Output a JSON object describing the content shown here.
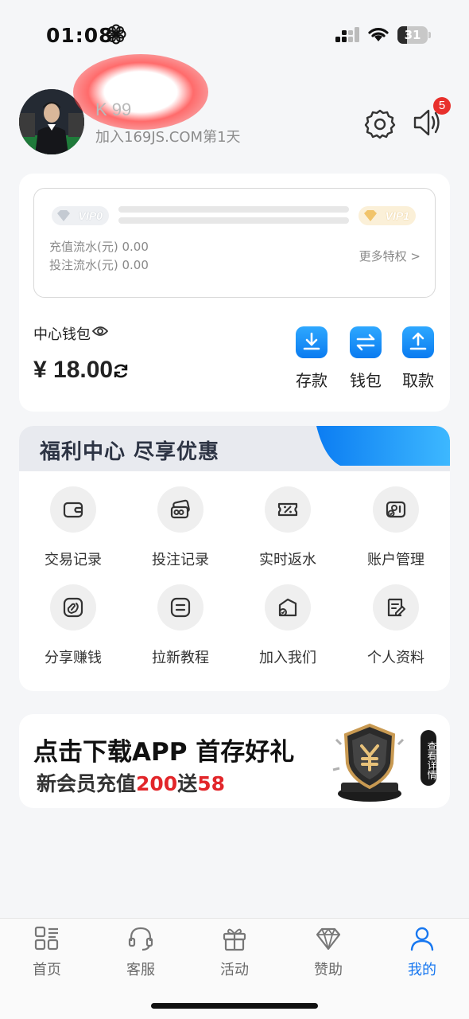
{
  "status_bar": {
    "time": "01:08",
    "battery": "31",
    "battery_level": 0.31
  },
  "profile": {
    "username": "K      99",
    "join_text": "加入169JS.COM第1天",
    "notification_count": "5"
  },
  "vip": {
    "current_level": "VIP0",
    "next_level": "VIP1",
    "recharge_flow": "充值流水(元) 0.00",
    "bet_flow": "投注流水(元) 0.00",
    "more_privileges": "更多特权 >"
  },
  "wallet": {
    "title": "中心钱包",
    "balance": "¥ 18.00",
    "actions": [
      {
        "label": "存款",
        "icon": "download-icon"
      },
      {
        "label": "钱包",
        "icon": "transfer-icon"
      },
      {
        "label": "取款",
        "icon": "upload-icon"
      }
    ]
  },
  "welfare": {
    "title": "福利中心 尽享优惠",
    "items": [
      {
        "label": "交易记录",
        "icon": "wallet-icon"
      },
      {
        "label": "投注记录",
        "icon": "bet-card-icon"
      },
      {
        "label": "实时返水",
        "icon": "rebate-icon"
      },
      {
        "label": "账户管理",
        "icon": "account-card-icon"
      },
      {
        "label": "分享赚钱",
        "icon": "share-icon"
      },
      {
        "label": "拉新教程",
        "icon": "tutorial-icon"
      },
      {
        "label": "加入我们",
        "icon": "bag-icon"
      },
      {
        "label": "个人资料",
        "icon": "profile-doc-icon"
      }
    ]
  },
  "banner": {
    "title": "点击下载APP 首存好礼",
    "sub_prefix": "新会员充值",
    "sub_amount1": "200",
    "sub_mid": "送",
    "sub_amount2": "58",
    "view_detail": "查看详情"
  },
  "bottom_nav": {
    "items": [
      {
        "label": "首页",
        "icon": "home-grid-icon"
      },
      {
        "label": "客服",
        "icon": "headset-icon"
      },
      {
        "label": "活动",
        "icon": "gift-icon"
      },
      {
        "label": "赞助",
        "icon": "diamond-icon"
      },
      {
        "label": "我的",
        "icon": "user-icon"
      }
    ],
    "active": "我的"
  },
  "colors": {
    "accent": "#1777f0",
    "badge": "#e8302c",
    "promo_red": "#e2262a"
  }
}
